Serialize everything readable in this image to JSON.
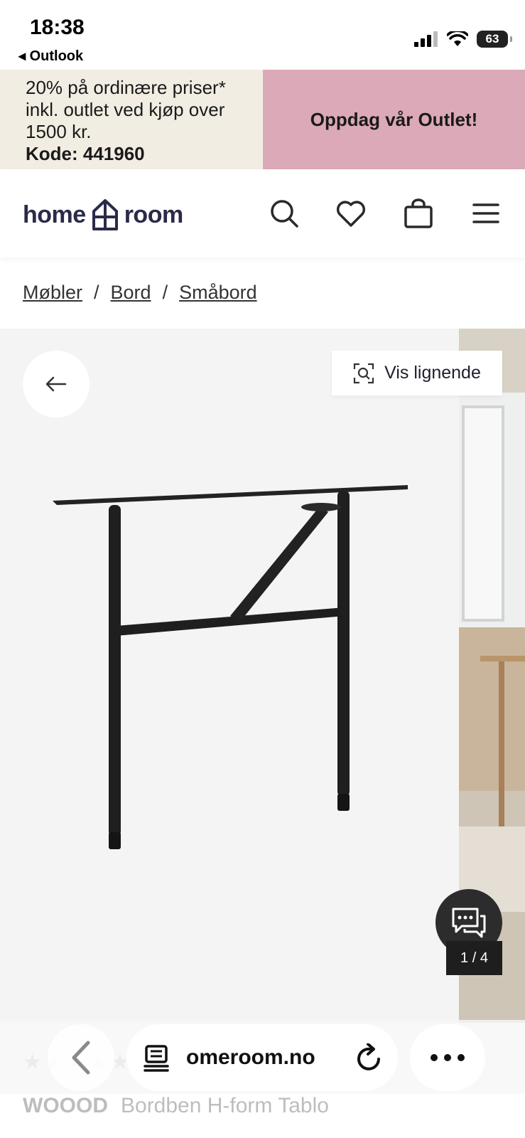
{
  "status_bar": {
    "time": "18:38",
    "back_app": "◂ Outlook",
    "battery": "63",
    "icons": [
      "signal-icon",
      "wifi-icon",
      "battery-icon"
    ]
  },
  "promo": {
    "left_text": "20% på ordinære priser* inkl. outlet ved kjøp over 1500 kr.",
    "left_code": "Kode: 441960",
    "right_text": "Oppdag vår Outlet!",
    "left_bg": "#f1ede3",
    "right_bg": "#dba9b8"
  },
  "header": {
    "logo_left": "home",
    "logo_right": "room",
    "icons": [
      "search-icon",
      "heart-icon",
      "bag-icon",
      "menu-icon"
    ]
  },
  "breadcrumb": {
    "items": [
      "Møbler",
      "Bord",
      "Småbord"
    ],
    "separator": "/"
  },
  "gallery": {
    "similar_label": "Vis lignende",
    "counter": "1 / 4"
  },
  "product": {
    "rating_stars": "★★★★★",
    "brand": "WOOOD",
    "title": "Bordben H-form Tablo"
  },
  "browser": {
    "url": "omeroom.no"
  }
}
